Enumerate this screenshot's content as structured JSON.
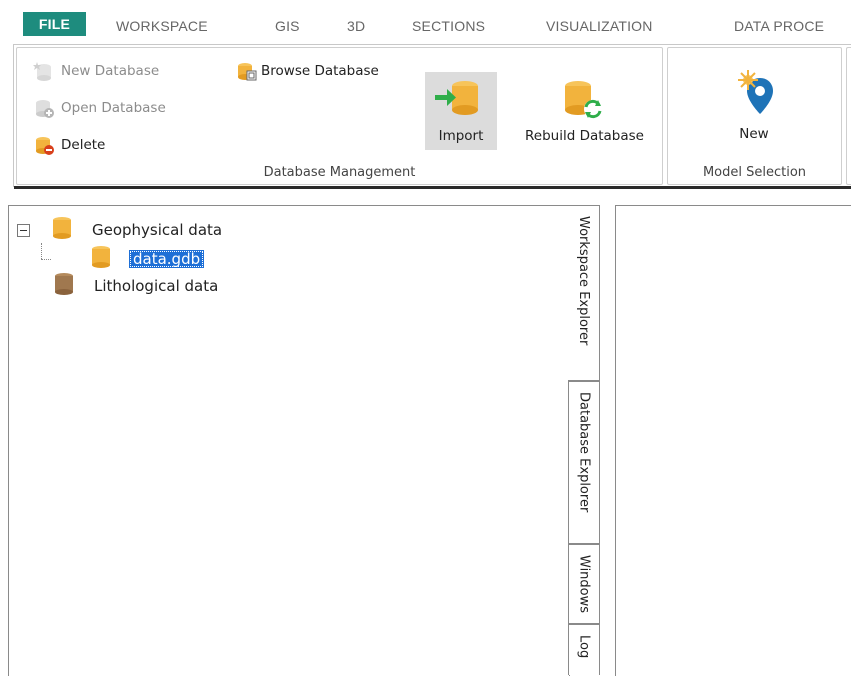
{
  "tabs": {
    "file": "FILE",
    "workspace": "WORKSPACE",
    "gis": "GIS",
    "three_d": "3D",
    "sections": "SECTIONS",
    "visualization": "VISUALIZATION",
    "data_proce": "DATA PROCE"
  },
  "ribbon": {
    "database_management": {
      "label": "Database Management",
      "new_database": "New Database",
      "open_database": "Open Database",
      "delete": "Delete",
      "browse_database": "Browse Database",
      "import": "Import",
      "rebuild_database": "Rebuild Database"
    },
    "model_selection": {
      "label": "Model Selection",
      "new": "New"
    }
  },
  "tree": {
    "items": [
      {
        "label": "Geophysical data",
        "expanded": true,
        "icon": "database-icon"
      },
      {
        "label": "data.gdb",
        "selected": true,
        "icon": "database-icon"
      },
      {
        "label": "Lithological data",
        "icon": "database-icon"
      }
    ],
    "expander": "⊟"
  },
  "side_tabs": {
    "workspace_explorer": "Workspace Explorer",
    "database_explorer": "Database Explorer",
    "windows": "Windows",
    "log": "Log"
  },
  "colors": {
    "file_tab": "#1e8c7e",
    "db_orange": "#f2b33d",
    "db_brown": "#a0784f",
    "selection": "#1e6fd6"
  }
}
